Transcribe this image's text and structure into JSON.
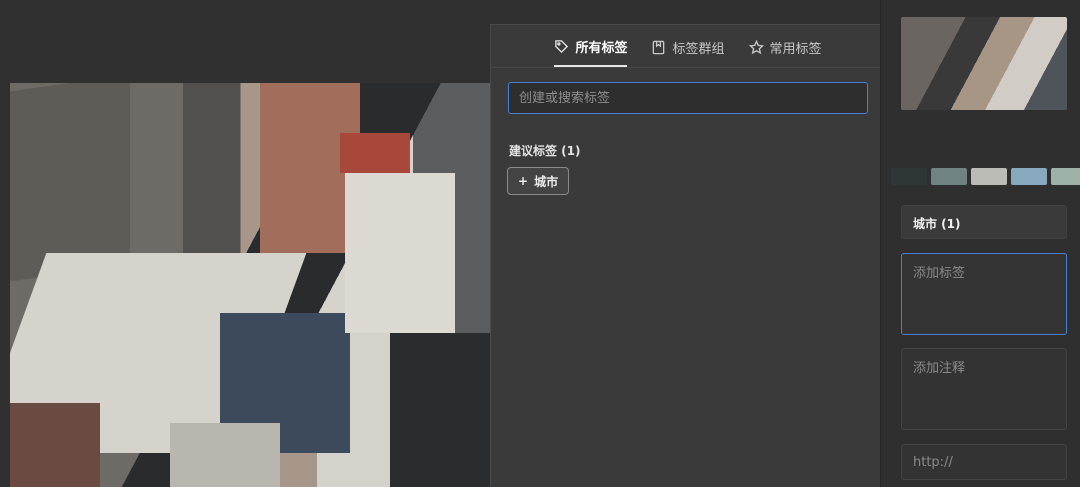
{
  "popover": {
    "tabs": [
      {
        "label": "所有标签",
        "icon": "tag-icon",
        "active": true
      },
      {
        "label": "标签群组",
        "icon": "bookmark-tag-icon",
        "active": false
      },
      {
        "label": "常用标签",
        "icon": "star-icon",
        "active": false
      }
    ],
    "search": {
      "placeholder": "创建或搜索标签"
    },
    "suggested": {
      "title": "建议标签 (1)",
      "tags": [
        {
          "prefix": "+",
          "label": "城市"
        }
      ]
    }
  },
  "inspector": {
    "colors": [
      "#2e3638",
      "#6f8383",
      "#bcbcb6",
      "#89a9bf",
      "#9eb2a8"
    ],
    "tag_chip": "城市 (1)",
    "add_tag": {
      "placeholder": "添加标签"
    },
    "add_note": {
      "placeholder": "添加注释"
    },
    "url": {
      "placeholder": "http://"
    }
  }
}
